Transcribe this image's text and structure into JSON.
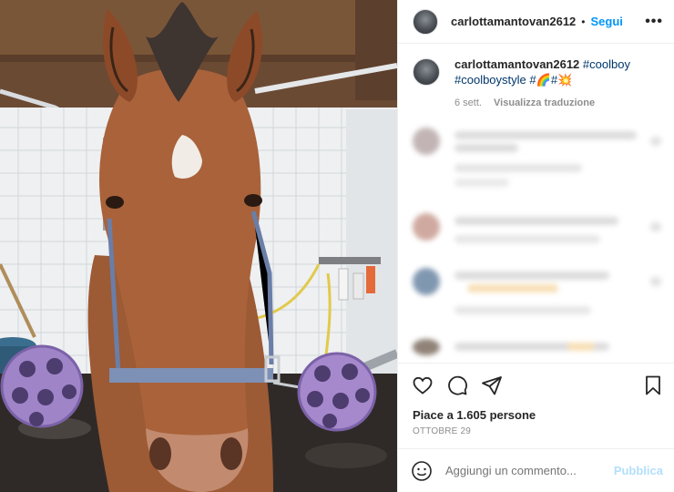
{
  "header": {
    "username": "carlottamantovan2612",
    "separator": "•",
    "follow_label": "Segui",
    "more_label": "•••"
  },
  "caption": {
    "username": "carlottamantovan2612",
    "tag1": "#coolboy",
    "tag2": "#coolboystyle",
    "tag3": "#🌈#💥",
    "time": "6 sett.",
    "translate_label": "Visualizza traduzione"
  },
  "blurred_comments": [
    {
      "avatar_color": "#b8a8a8"
    },
    {
      "avatar_color": "#c79b8f"
    },
    {
      "avatar_color": "#6b86a3"
    },
    {
      "avatar_color": "#7d6d60"
    }
  ],
  "actions": {
    "like_icon": "heart-icon",
    "comment_icon": "comment-icon",
    "share_icon": "share-icon",
    "save_icon": "bookmark-icon"
  },
  "likes_text": "Piace a 1.605 persone",
  "date_text": "OTTOBRE 29",
  "compose": {
    "placeholder": "Aggiungi un commento...",
    "publish_label": "Pubblica",
    "emoji_icon": "smiley-icon"
  },
  "colors": {
    "accent": "#0095f6",
    "hashtag": "#00376b",
    "muted": "#8e8e8e",
    "publish_disabled": "#b2dffc"
  }
}
